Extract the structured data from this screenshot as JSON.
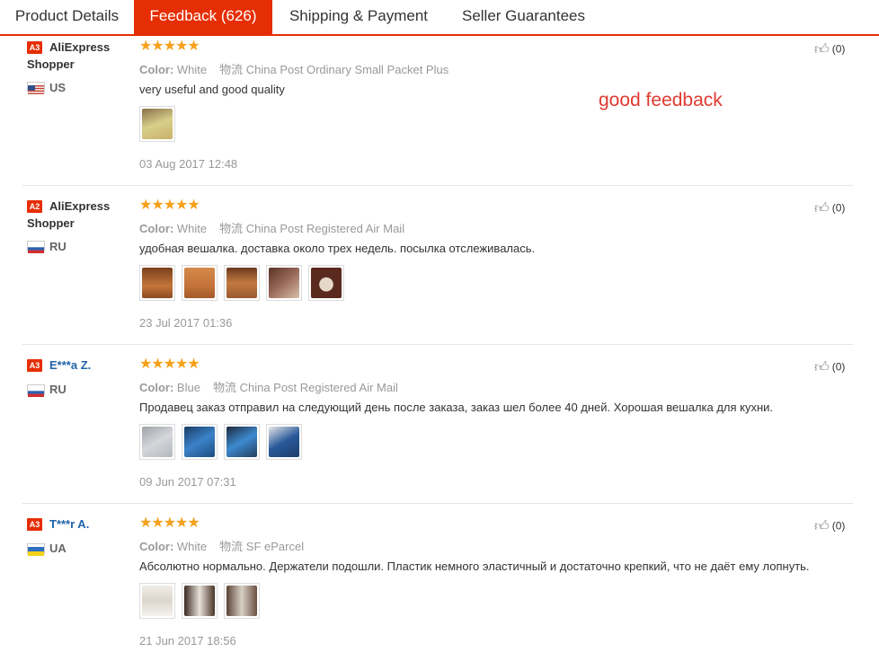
{
  "tabs": [
    {
      "label": "Product Details"
    },
    {
      "label": "Feedback (626)"
    },
    {
      "label": "Shipping & Payment"
    },
    {
      "label": "Seller Guarantees"
    }
  ],
  "annotation": "good feedback",
  "labels": {
    "color": "Color:",
    "logistics": "物流"
  },
  "reviews": [
    {
      "level": "A3",
      "name_line1": "AliExpress",
      "name_line2": "Shopper",
      "country": "US",
      "stars": "★★★★★",
      "color": "White",
      "shipping": "China Post Ordinary Small Packet Plus",
      "text": "very useful and good quality",
      "date": "03 Aug 2017 12:48",
      "likes": "(0)",
      "thumbs": [
        "#c9b889"
      ]
    },
    {
      "level": "A2",
      "name_line1": "AliExpress",
      "name_line2": "Shopper",
      "country": "RU",
      "stars": "★★★★★",
      "color": "White",
      "shipping": "China Post Registered Air Mail",
      "text": "удобная вешалка. доставка около трех недель. посылка отслеживалась.",
      "date": "23 Jul 2017 01:36",
      "likes": "(0)",
      "thumbs": [
        "#a8612f",
        "#c67a3e",
        "#b36a34",
        "#8a5040",
        "#6e3a2c"
      ]
    },
    {
      "level": "A3",
      "name_line1": "E***a Z.",
      "name_line2": "",
      "country": "RU",
      "stars": "★★★★★",
      "color": "Blue",
      "shipping": "China Post Registered Air Mail",
      "text": "Продавец заказ отправил на следующий день после заказа, заказ шел более 40 дней. Хорошая вешалка для кухни.",
      "date": "09 Jun 2017 07:31",
      "likes": "(0)",
      "thumbs": [
        "#b9bcc0",
        "#2a5f9a",
        "#2d6fb0",
        "#24508a"
      ]
    },
    {
      "level": "A3",
      "name_line1": "T***r A.",
      "name_line2": "",
      "country": "UA",
      "stars": "★★★★★",
      "color": "White",
      "shipping": "SF eParcel",
      "text": "Абсолютно нормально. Держатели подошли. Пластик немного эластичный и достаточно крепкий, что не даёт ему лопнуть.",
      "date": "21 Jun 2017 18:56",
      "likes": "(0)",
      "thumbs": [
        "#e8e4de",
        "#7a5a42",
        "#8c6a50"
      ]
    }
  ]
}
